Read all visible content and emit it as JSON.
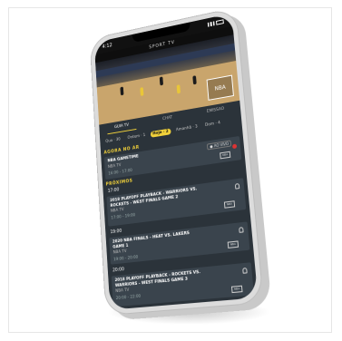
{
  "status": {
    "time": "4:12"
  },
  "app": {
    "title": "SPORT TV"
  },
  "video": {
    "overlay_logo": "NBA"
  },
  "tabs": [
    {
      "label": "GUIA TV",
      "active": true
    },
    {
      "label": "CHAT",
      "active": false
    },
    {
      "label": "EMISSAO",
      "active": false
    }
  ],
  "days": [
    {
      "label": "Qua · 30",
      "active": false
    },
    {
      "label": "Ontem · 1",
      "active": false
    },
    {
      "label": "Hoje · 2",
      "active": true
    },
    {
      "label": "Amanhã · 3",
      "active": false
    },
    {
      "label": "Dom · 4",
      "active": false
    }
  ],
  "sections": {
    "on_air": "AGORA NO AR",
    "next": "PRÓXIMOS"
  },
  "on_air": {
    "title": "NBA GAMETIME",
    "channel": "NBA TV",
    "time": "16:00 - 17:00",
    "badge": "● AO VIVO",
    "logo": "NBA"
  },
  "schedule": [
    {
      "slot": "17:00",
      "title": "2018 PLAYOFF PLAYBACK - WARRIORS VS. ROCKETS - WEST FINALS GAME 2",
      "channel": "NBA TV",
      "time": "17:00 - 19:00",
      "logo": "NBA"
    },
    {
      "slot": "19:00",
      "title": "2020 NBA FINALS - HEAT VS. LAKERS GAME 1",
      "channel": "NBA TV",
      "time": "19:00 - 20:00",
      "logo": "NBA"
    },
    {
      "slot": "20:00",
      "title": "2018 PLAYOFF PLAYBACK - ROCKETS VS. WARRIORS - WEST FINALS GAME 3",
      "channel": "NBA TV",
      "time": "20:00 - 22:00",
      "logo": "NBA"
    }
  ],
  "colors": {
    "accent": "#f2d23a",
    "background": "#2b333a",
    "card": "#3a444d",
    "live": "#dd3333"
  }
}
